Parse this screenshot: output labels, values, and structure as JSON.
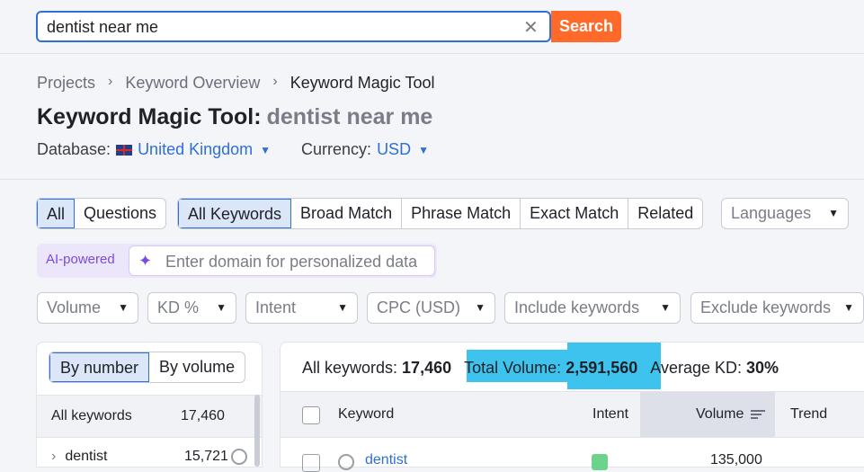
{
  "search": {
    "value": "dentist near me",
    "clear_icon": "close-icon",
    "button_label": "Search"
  },
  "breadcrumb": [
    "Projects",
    "Keyword Overview",
    "Keyword Magic Tool"
  ],
  "title": {
    "tool": "Keyword Magic Tool:",
    "query": "dentist near me"
  },
  "database": {
    "label": "Database:",
    "value": "United Kingdom",
    "flag_icon": "uk-flag-icon"
  },
  "currency": {
    "label": "Currency:",
    "value": "USD"
  },
  "question_filter": {
    "options": [
      "All",
      "Questions"
    ],
    "active": "All"
  },
  "match_filter": {
    "options": [
      "All Keywords",
      "Broad Match",
      "Phrase Match",
      "Exact Match",
      "Related"
    ],
    "active": "All Keywords"
  },
  "languages": {
    "label": "Languages"
  },
  "ai": {
    "label": "AI-powered",
    "placeholder": "Enter domain for personalized data",
    "icon": "sparkle-icon"
  },
  "filters": [
    "Volume",
    "KD %",
    "Intent",
    "CPC (USD)",
    "Include keywords",
    "Exclude keywords"
  ],
  "group_toggle": {
    "options": [
      "By number",
      "By volume"
    ],
    "active": "By number"
  },
  "groups": {
    "header_label": "All keywords",
    "header_value": "17,460",
    "rows": [
      {
        "label": "dentist",
        "value": "15,721"
      }
    ]
  },
  "stats": {
    "all_keywords_label": "All keywords:",
    "all_keywords_value": "17,460",
    "total_volume_label": "Total Volume:",
    "total_volume_value": "2,591,560",
    "avg_kd_label": "Average KD:",
    "avg_kd_value": "30%",
    "highlight_color": "#3ec3ef"
  },
  "table": {
    "columns": [
      "Keyword",
      "Intent",
      "Volume",
      "Trend"
    ],
    "rows": [
      {
        "keyword": "dentist",
        "volume": "135,000"
      }
    ]
  },
  "colors": {
    "accent": "#2e6fd8",
    "search_button": "#ff6a2b",
    "ai_purple": "#7a4be0"
  }
}
